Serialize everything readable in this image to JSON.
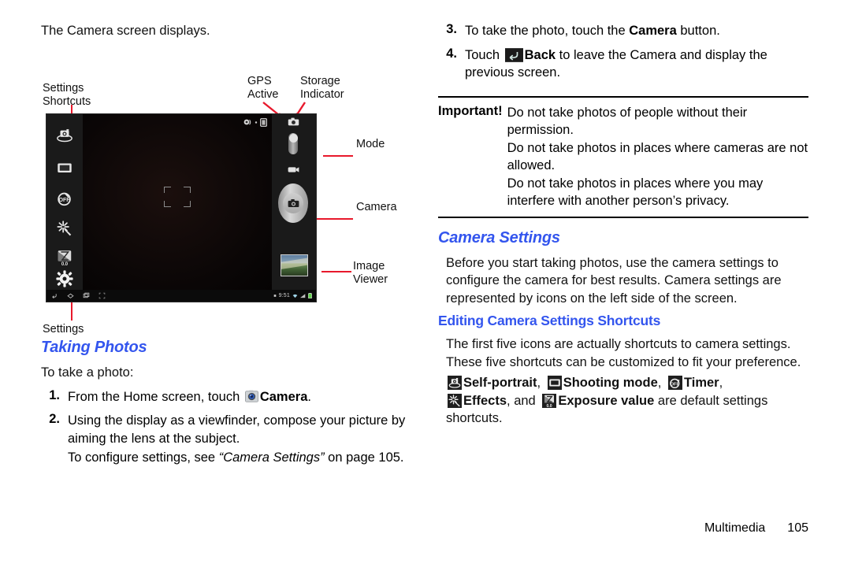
{
  "document": {
    "type": "user-manual-page",
    "footer": {
      "section": "Multimedia",
      "page_number": "105"
    }
  },
  "left_column": {
    "intro": "The Camera screen displays.",
    "figure": {
      "callouts": {
        "settings_shortcuts": "Settings\nShortcuts",
        "gps_active": "GPS\nActive",
        "storage_indicator": "Storage\nIndicator",
        "mode": "Mode",
        "camera": "Camera",
        "image_viewer": "Image\nViewer",
        "settings": "Settings"
      },
      "device_screen": {
        "status_time": "9:51",
        "rail_icons": [
          "self-portrait-icon",
          "shooting-mode-icon",
          "timer-icon",
          "effects-icon",
          "exposure-value-icon",
          "settings-gear-icon"
        ],
        "nav_icons": [
          "back-icon",
          "home-icon",
          "recents-icon",
          "screenshot-icon"
        ],
        "status_icons": [
          "gps-active-icon",
          "storage-indicator-icon"
        ],
        "tray_icons": [
          "notification-dot-icon",
          "wifi-icon",
          "signal-icon",
          "battery-icon"
        ]
      }
    },
    "heading": "Taking Photos",
    "lead_in": "To take a photo:",
    "steps": [
      {
        "number": "1.",
        "parts": [
          {
            "t": "From the Home screen, touch ",
            "style": "normal"
          },
          {
            "t": "icon:camera-app-icon",
            "style": "icon"
          },
          {
            "t": "Camera",
            "style": "bold"
          },
          {
            "t": ".",
            "style": "normal"
          }
        ]
      },
      {
        "number": "2.",
        "parts": [
          {
            "t": "Using the display as a viewfinder, compose your picture by aiming the lens at the subject.",
            "style": "normal"
          }
        ],
        "continuation": [
          {
            "t": "To configure settings, see ",
            "style": "normal"
          },
          {
            "t": "“Camera Settings”",
            "style": "italic"
          },
          {
            "t": " on page 105.",
            "style": "normal"
          }
        ]
      }
    ]
  },
  "right_column": {
    "steps": [
      {
        "number": "3.",
        "parts": [
          {
            "t": "To take the photo, touch the ",
            "style": "normal"
          },
          {
            "t": "Camera",
            "style": "bold"
          },
          {
            "t": " button.",
            "style": "normal"
          }
        ]
      },
      {
        "number": "4.",
        "parts": [
          {
            "t": "Touch ",
            "style": "normal"
          },
          {
            "t": "icon:back-button-icon",
            "style": "icon"
          },
          {
            "t": "Back",
            "style": "bold"
          },
          {
            "t": " to leave the Camera and display the previous screen.",
            "style": "normal"
          }
        ]
      }
    ],
    "important": {
      "label": "Important!",
      "lines": [
        "Do not take photos of people without their permission.",
        "Do not take photos in places where cameras are not allowed.",
        "Do not take photos in places where you may interfere with another person’s privacy."
      ]
    },
    "camera_settings": {
      "heading": "Camera Settings",
      "paragraph": "Before you start taking photos, use the camera settings to configure the camera for best results. Camera settings are represented by icons on the left side of the screen.",
      "sub_heading": "Editing Camera Settings Shortcuts",
      "sub_paragraph": "The first five icons are actually shortcuts to camera settings. These five shortcuts can be customized to fit your preference.",
      "shortcut_list": {
        "items": [
          {
            "icon": "self-portrait-icon",
            "label": "Self-portrait",
            "sep": ","
          },
          {
            "icon": "shooting-mode-icon",
            "label": "Shooting mode",
            "sep": ","
          },
          {
            "icon": "timer-icon",
            "label": "Timer",
            "sep": ","
          },
          {
            "icon": "effects-icon",
            "label": "Effects",
            "sep": ", and"
          },
          {
            "icon": "exposure-value-icon",
            "label": "Exposure value",
            "sep": ""
          }
        ],
        "tail": "are default settings shortcuts."
      }
    }
  },
  "colors": {
    "heading_blue": "#3355ee",
    "callout_red": "#e8192c",
    "text_black": "#111111"
  }
}
